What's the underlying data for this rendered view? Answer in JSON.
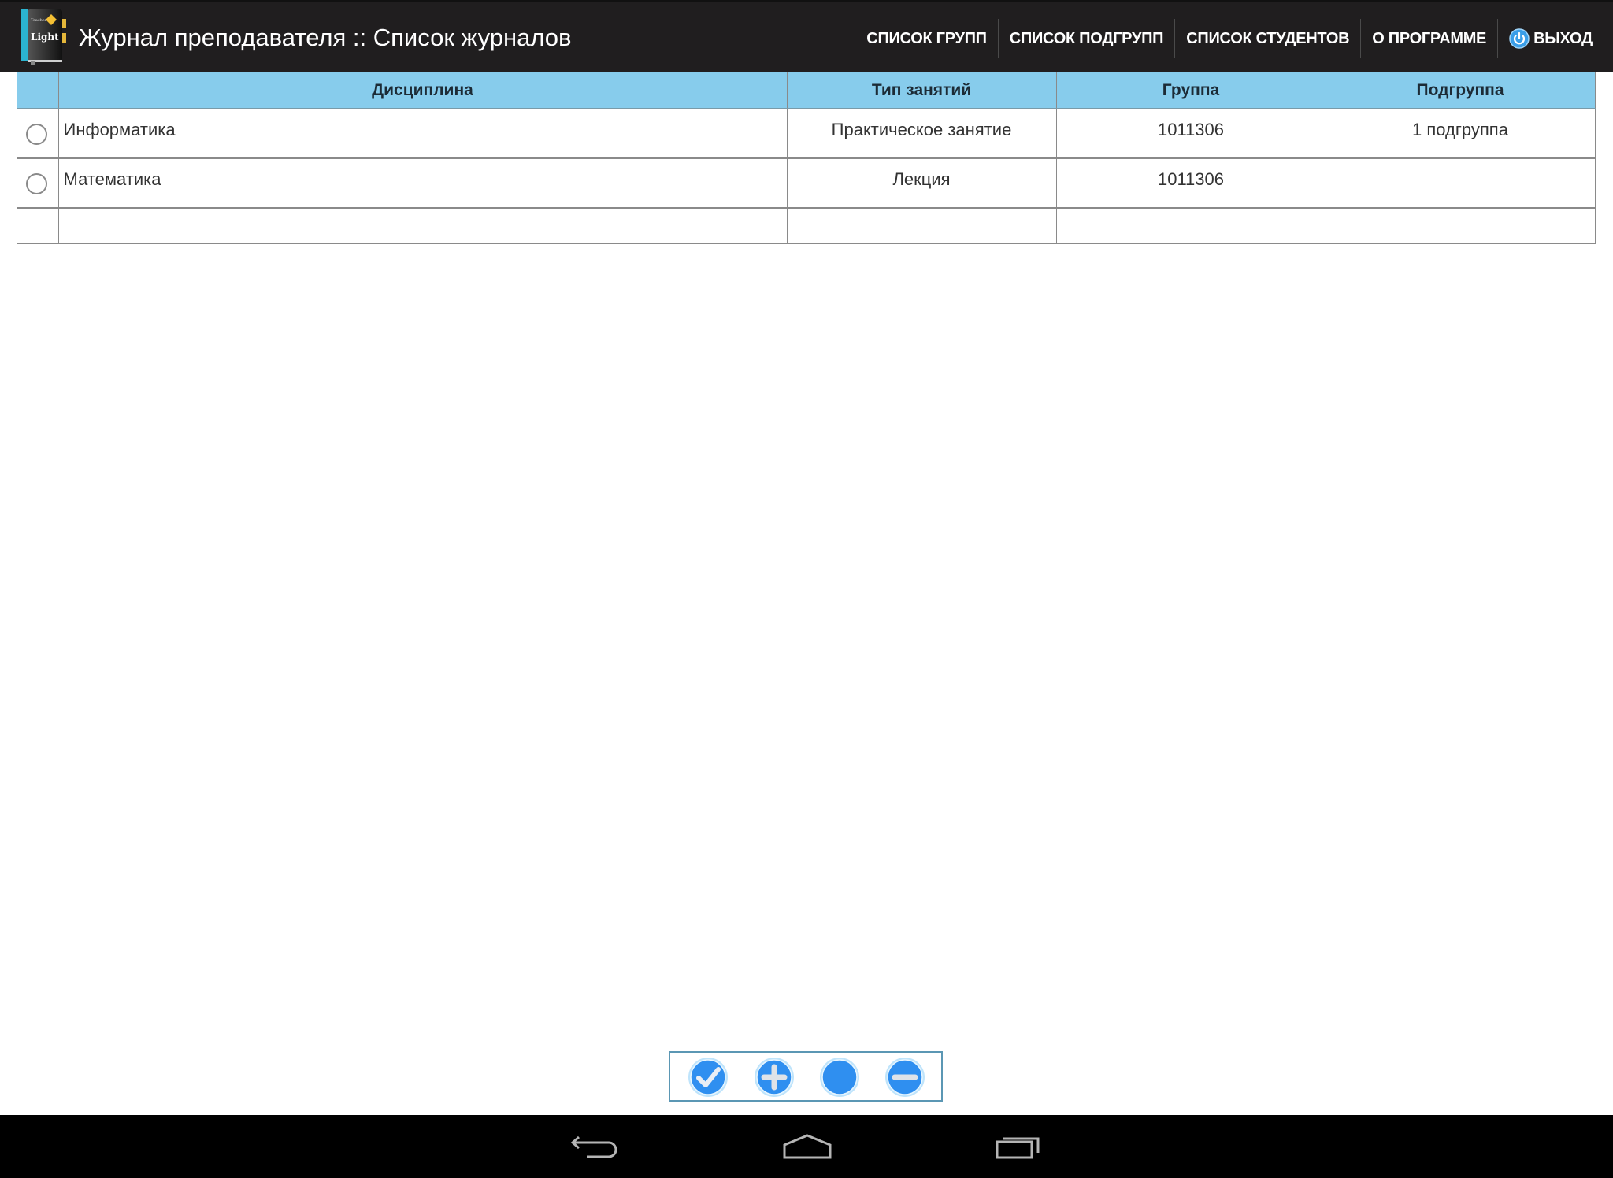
{
  "app": {
    "logo_text": "Light",
    "logo_subtext": "Teacher",
    "title": "Журнал преподавателя :: Список журналов"
  },
  "menu": {
    "items": [
      {
        "label": "СПИСОК ГРУПП"
      },
      {
        "label": "СПИСОК ПОДГРУПП"
      },
      {
        "label": "СПИСОК СТУДЕНТОВ"
      },
      {
        "label": "О ПРОГРАММЕ"
      },
      {
        "label": "ВЫХОД",
        "icon": "power-icon"
      }
    ]
  },
  "table": {
    "columns": [
      "",
      "Дисциплина",
      "Тип занятий",
      "Группа",
      "Подгруппа"
    ],
    "rows": [
      {
        "selected": false,
        "discipline": "Информатика",
        "type": "Практическое занятие",
        "group": "1011306",
        "subgroup": "1 подгруппа"
      },
      {
        "selected": false,
        "discipline": "Математика",
        "type": "Лекция",
        "group": "1011306",
        "subgroup": ""
      }
    ]
  },
  "toolbar": {
    "buttons": [
      {
        "icon": "check-icon",
        "action": "open"
      },
      {
        "icon": "plus-icon",
        "action": "add"
      },
      {
        "icon": "circle-icon",
        "action": "edit"
      },
      {
        "icon": "minus-icon",
        "action": "delete"
      }
    ]
  },
  "navbar": {
    "buttons": [
      {
        "icon": "back-icon"
      },
      {
        "icon": "home-icon"
      },
      {
        "icon": "recent-apps-icon"
      }
    ]
  },
  "colors": {
    "titlebar_bg": "#201e1f",
    "table_header_bg": "#87ccec",
    "accent_blue": "#2f8ff0",
    "navbar_bg": "#000000"
  }
}
